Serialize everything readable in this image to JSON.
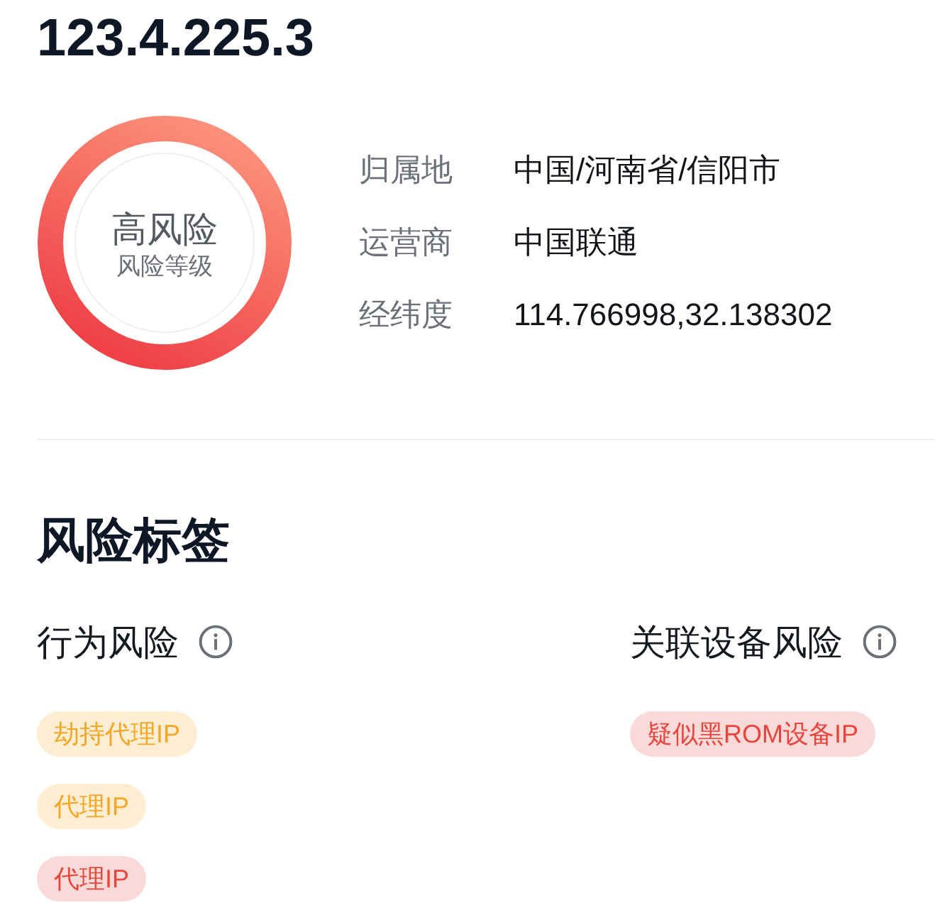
{
  "ip": "123.4.225.3",
  "risk": {
    "level_text": "高风险",
    "caption": "风险等级"
  },
  "info": [
    {
      "label": "归属地",
      "value": "中国/河南省/信阳市"
    },
    {
      "label": "运营商",
      "value": "中国联通"
    },
    {
      "label": "经纬度",
      "value": "114.766998,32.138302"
    }
  ],
  "risk_tags": {
    "title": "风险标签",
    "groups": [
      {
        "title": "行为风险",
        "tags": [
          {
            "text": "劫持代理IP",
            "color": "#f5a623"
          },
          {
            "text": "代理IP",
            "color": "#f5a623"
          },
          {
            "text": "代理IP",
            "color": "#e8453c"
          }
        ]
      },
      {
        "title": "关联设备风险",
        "tags": [
          {
            "text": "疑似黑ROM设备IP",
            "color": "#e8453c"
          }
        ]
      }
    ]
  }
}
